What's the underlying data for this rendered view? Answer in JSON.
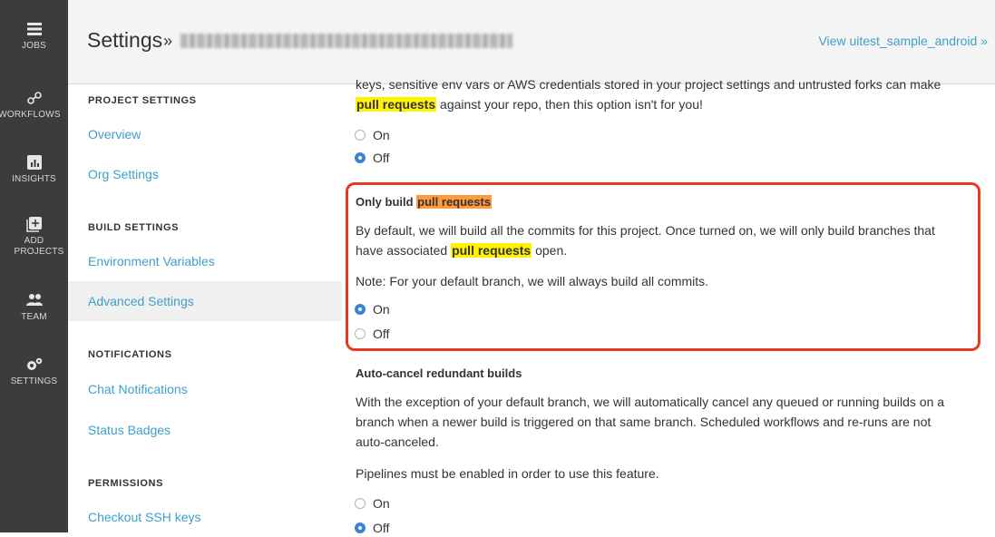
{
  "rail": {
    "items": [
      {
        "label": "JOBS",
        "icon": "jobs-icon"
      },
      {
        "label": "WORKFLOWS",
        "icon": "workflows-icon"
      },
      {
        "label": "INSIGHTS",
        "icon": "insights-icon"
      },
      {
        "label": "ADD PROJECTS",
        "icon": "add-projects-icon"
      },
      {
        "label": "TEAM",
        "icon": "team-icon"
      },
      {
        "label": "SETTINGS",
        "icon": "settings-icon"
      }
    ]
  },
  "header": {
    "title": "Settings",
    "separator": "»",
    "view_link": "View uitest_sample_android »"
  },
  "nav": {
    "project_settings": "PROJECT SETTINGS",
    "overview": "Overview",
    "org_settings": "Org Settings",
    "build_settings": "BUILD SETTINGS",
    "environment_variables": "Environment Variables",
    "advanced_settings": "Advanced Settings",
    "notifications": "NOTIFICATIONS",
    "chat_notifications": "Chat Notifications",
    "status_badges": "Status Badges",
    "permissions": "PERMISSIONS",
    "checkout_ssh_keys": "Checkout SSH keys"
  },
  "main": {
    "top_para_1": "keys, sensitive env vars or AWS credentials stored in your project settings and untrusted forks can make",
    "top_para_2_hl": "pull requests",
    "top_para_2_rest": " against your repo, then this option isn't for you!",
    "top_radio_on": "On",
    "top_radio_off": "Off",
    "pr_heading_prefix": "Only build ",
    "pr_heading_hl": "pull requests",
    "pr_desc_1": "By default, we will build all the commits for this project. Once turned on, we will only build branches that",
    "pr_desc_2_prefix": "have associated ",
    "pr_desc_2_hl": "pull requests",
    "pr_desc_2_suffix": " open.",
    "pr_note": "Note: For your default branch, we will always build all commits.",
    "pr_radio_on": "On",
    "pr_radio_off": "Off",
    "ac_heading": "Auto-cancel redundant builds",
    "ac_desc_1": "With the exception of your default branch, we will automatically cancel any queued or running builds on a",
    "ac_desc_2": "branch when a newer build is triggered on that same branch. Scheduled workflows and re-runs are not",
    "ac_desc_3": "auto-canceled.",
    "ac_note": "Pipelines must be enabled in order to use this feature.",
    "ac_radio_on": "On",
    "ac_radio_off": "Off"
  },
  "colors": {
    "rail_bg": "#3c3c3c",
    "link": "#3f9fc8",
    "highlight_yellow": "#fff200",
    "highlight_orange": "#ff9a3c",
    "annotation_red": "#e53920",
    "radio_selected": "#3a84d6"
  }
}
